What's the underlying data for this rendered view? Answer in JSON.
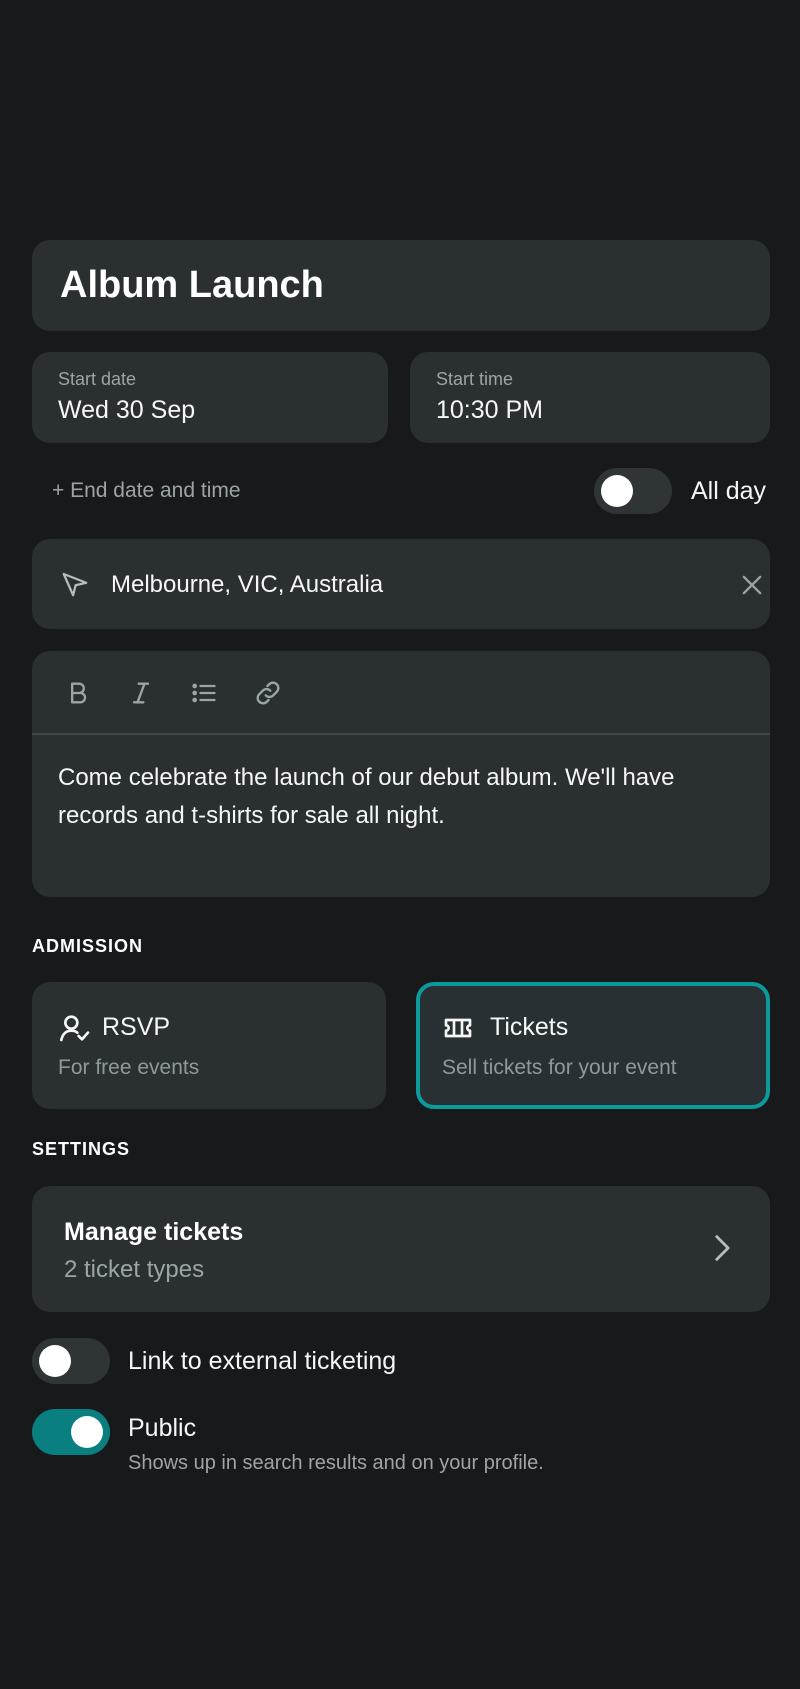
{
  "event": {
    "title": "Album Launch"
  },
  "datetime": {
    "start_date_label": "Start date",
    "start_date_value": "Wed 30 Sep",
    "start_time_label": "Start time",
    "start_time_value": "10:30 PM",
    "end_date_link": "+ End date and time",
    "all_day_label": "All day",
    "all_day_on": false
  },
  "location": {
    "value": "Melbourne, VIC, Australia",
    "icon": "location-arrow-icon",
    "clear_icon": "close-icon"
  },
  "description": {
    "toolbar": [
      "bold-icon",
      "italic-icon",
      "bullet-list-icon",
      "link-icon"
    ],
    "text": "Come celebrate the launch of our debut album. We'll have records and t-shirts for sale all night."
  },
  "admission": {
    "header": "ADMISSION",
    "options": [
      {
        "title": "RSVP",
        "subtitle": "For free events",
        "icon": "user-check-icon",
        "selected": false
      },
      {
        "title": "Tickets",
        "subtitle": "Sell tickets for your event",
        "icon": "ticket-icon",
        "selected": true
      }
    ]
  },
  "settings": {
    "header": "SETTINGS",
    "manage_title": "Manage tickets",
    "manage_sub": "2 ticket types",
    "external_label": "Link to external ticketing",
    "external_on": false,
    "public_label": "Public",
    "public_sub": "Shows up in search results and on your profile.",
    "public_on": true
  },
  "colors": {
    "background": "#18191b",
    "card": "#2a2f30",
    "accent": "#0d9a9a",
    "toggle_on": "#0a7f80"
  }
}
